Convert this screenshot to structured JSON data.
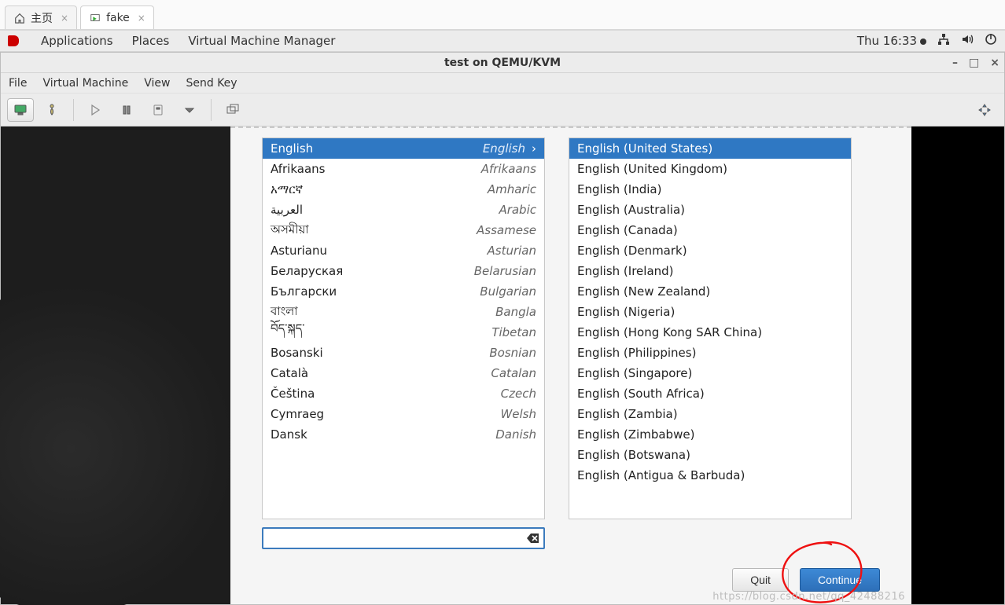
{
  "outer_tabs": [
    {
      "label": "主页",
      "active": false,
      "icon": "home-icon"
    },
    {
      "label": "fake",
      "active": true,
      "icon": "vm-icon"
    }
  ],
  "panel": {
    "menus": [
      "Applications",
      "Places",
      "Virtual Machine Manager"
    ],
    "clock": "Thu 16:33"
  },
  "vmwin": {
    "title": "test on QEMU/KVM",
    "menubar": [
      "File",
      "Virtual Machine",
      "View",
      "Send Key"
    ]
  },
  "search": {
    "value": "",
    "placeholder": ""
  },
  "languages": [
    {
      "native": "English",
      "english": "English",
      "selected": true
    },
    {
      "native": "Afrikaans",
      "english": "Afrikaans",
      "selected": false
    },
    {
      "native": "አማርኛ",
      "english": "Amharic",
      "selected": false
    },
    {
      "native": "العربية",
      "english": "Arabic",
      "selected": false
    },
    {
      "native": "অসমীয়া",
      "english": "Assamese",
      "selected": false
    },
    {
      "native": "Asturianu",
      "english": "Asturian",
      "selected": false
    },
    {
      "native": "Беларуская",
      "english": "Belarusian",
      "selected": false
    },
    {
      "native": "Български",
      "english": "Bulgarian",
      "selected": false
    },
    {
      "native": "বাংলা",
      "english": "Bangla",
      "selected": false
    },
    {
      "native": "བོད་སྐད་",
      "english": "Tibetan",
      "selected": false
    },
    {
      "native": "Bosanski",
      "english": "Bosnian",
      "selected": false
    },
    {
      "native": "Català",
      "english": "Catalan",
      "selected": false
    },
    {
      "native": "Čeština",
      "english": "Czech",
      "selected": false
    },
    {
      "native": "Cymraeg",
      "english": "Welsh",
      "selected": false
    },
    {
      "native": "Dansk",
      "english": "Danish",
      "selected": false
    }
  ],
  "locales": [
    {
      "label": "English (United States)",
      "selected": true
    },
    {
      "label": "English (United Kingdom)",
      "selected": false
    },
    {
      "label": "English (India)",
      "selected": false
    },
    {
      "label": "English (Australia)",
      "selected": false
    },
    {
      "label": "English (Canada)",
      "selected": false
    },
    {
      "label": "English (Denmark)",
      "selected": false
    },
    {
      "label": "English (Ireland)",
      "selected": false
    },
    {
      "label": "English (New Zealand)",
      "selected": false
    },
    {
      "label": "English (Nigeria)",
      "selected": false
    },
    {
      "label": "English (Hong Kong SAR China)",
      "selected": false
    },
    {
      "label": "English (Philippines)",
      "selected": false
    },
    {
      "label": "English (Singapore)",
      "selected": false
    },
    {
      "label": "English (South Africa)",
      "selected": false
    },
    {
      "label": "English (Zambia)",
      "selected": false
    },
    {
      "label": "English (Zimbabwe)",
      "selected": false
    },
    {
      "label": "English (Botswana)",
      "selected": false
    },
    {
      "label": "English (Antigua & Barbuda)",
      "selected": false
    }
  ],
  "footer": {
    "quit": "Quit",
    "continue": "Continue"
  },
  "watermark": "https://blog.csdn.net/qq_42488216"
}
